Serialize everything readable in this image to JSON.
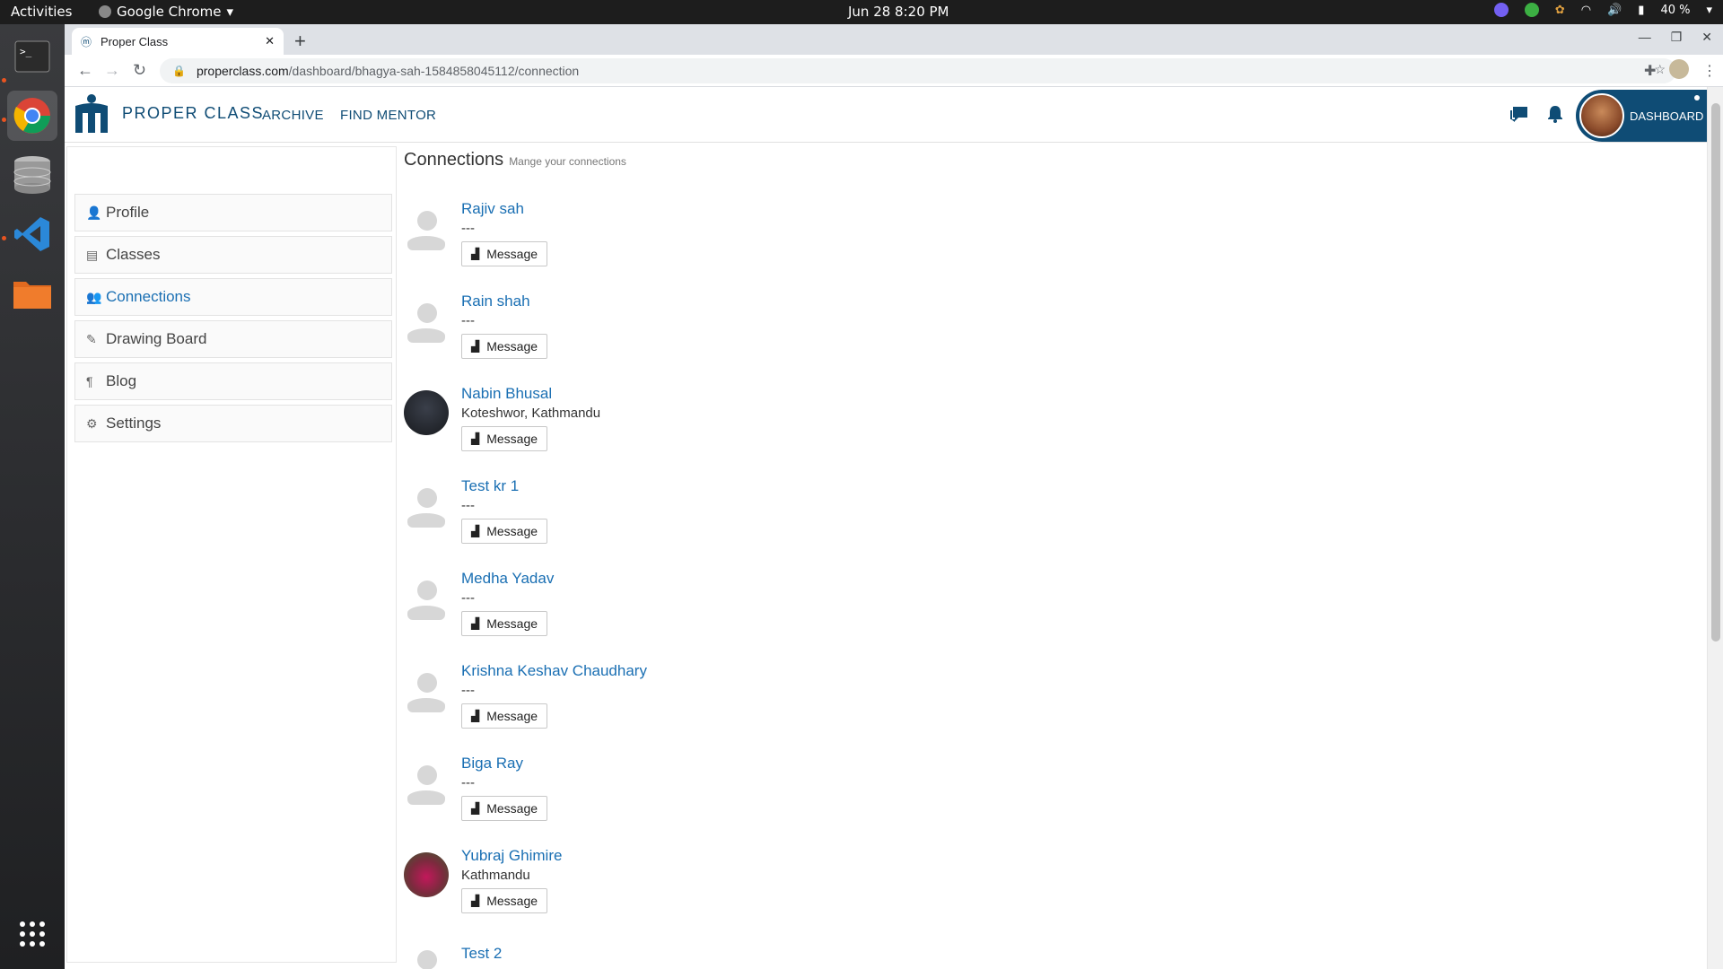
{
  "system": {
    "activities": "Activities",
    "app_name": "Google Chrome",
    "clock": "Jun 28  8:20 PM",
    "battery": "40 %"
  },
  "browser": {
    "tab_title": "Proper Class",
    "url_host": "properclass.com",
    "url_path": "/dashboard/bhagya-sah-1584858045112/connection"
  },
  "site": {
    "brand": "PROPER CLASS",
    "nav": [
      {
        "label": "ARCHIVE"
      },
      {
        "label": "FIND MENTOR"
      }
    ],
    "dashboard_label": "DASHBOARD"
  },
  "sidebar": {
    "items": [
      {
        "label": "Profile",
        "icon": "user-icon"
      },
      {
        "label": "Classes",
        "icon": "inbox-icon"
      },
      {
        "label": "Connections",
        "icon": "users-icon",
        "active": true
      },
      {
        "label": "Drawing Board",
        "icon": "pen-icon"
      },
      {
        "label": "Blog",
        "icon": "paragraph-icon"
      },
      {
        "label": "Settings",
        "icon": "gear-icon"
      }
    ]
  },
  "main": {
    "title": "Connections",
    "subtitle": "Mange your connections",
    "message_label": "Message",
    "connections": [
      {
        "name": "Rajiv sah",
        "location": "---",
        "avatar": "default"
      },
      {
        "name": "Rain shah",
        "location": "---",
        "avatar": "default"
      },
      {
        "name": "Nabin Bhusal",
        "location": "Koteshwor, Kathmandu",
        "avatar": "photo"
      },
      {
        "name": "Test kr 1",
        "location": "---",
        "avatar": "default"
      },
      {
        "name": "Medha Yadav",
        "location": "---",
        "avatar": "default"
      },
      {
        "name": "Krishna Keshav Chaudhary",
        "location": "---",
        "avatar": "default"
      },
      {
        "name": "Biga Ray",
        "location": "---",
        "avatar": "default"
      },
      {
        "name": "Yubraj Ghimire",
        "location": "Kathmandu",
        "avatar": "photo"
      },
      {
        "name": "Test 2",
        "location": "---",
        "avatar": "default"
      }
    ]
  },
  "colors": {
    "brand": "#0f4c75",
    "link": "#1a6fb3"
  }
}
